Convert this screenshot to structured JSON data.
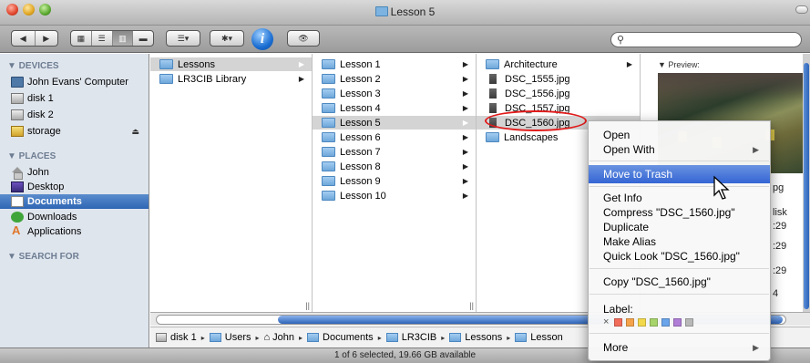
{
  "window": {
    "title": "Lesson 5"
  },
  "toolbar": {
    "nav": [
      "◀",
      "▶"
    ],
    "views": [
      "▦",
      "☰",
      "▥",
      "▬"
    ],
    "arrange": "☰▾",
    "action": "✱▾",
    "quicklook": "👁",
    "info": "i",
    "search_placeholder": ""
  },
  "sidebar": {
    "devices_heading": "▼ DEVICES",
    "devices": [
      {
        "label": "John Evans' Computer",
        "icon": "computer-icon"
      },
      {
        "label": "disk 1",
        "icon": "disk-icon"
      },
      {
        "label": "disk 2",
        "icon": "disk-icon"
      },
      {
        "label": "storage",
        "icon": "storage-icon"
      }
    ],
    "eject": "⏏",
    "places_heading": "▼ PLACES",
    "places": [
      {
        "label": "John",
        "icon": "home-icon"
      },
      {
        "label": "Desktop",
        "icon": "desktop-icon"
      },
      {
        "label": "Documents",
        "icon": "documents-icon",
        "selected": true
      },
      {
        "label": "Downloads",
        "icon": "downloads-icon"
      },
      {
        "label": "Applications",
        "icon": "applications-icon"
      }
    ],
    "search_heading": "▼ SEARCH FOR"
  },
  "columns": {
    "col1": [
      {
        "label": "Lessons",
        "selected": true,
        "arrow": "▶"
      },
      {
        "label": "LR3CIB Library",
        "arrow": "▶"
      }
    ],
    "col2": [
      {
        "label": "Lesson 1",
        "arrow": "▶"
      },
      {
        "label": "Lesson 2",
        "arrow": "▶"
      },
      {
        "label": "Lesson 3",
        "arrow": "▶"
      },
      {
        "label": "Lesson 4",
        "arrow": "▶"
      },
      {
        "label": "Lesson 5",
        "arrow": "▶",
        "selected": true
      },
      {
        "label": "Lesson 6",
        "arrow": "▶"
      },
      {
        "label": "Lesson 7",
        "arrow": "▶"
      },
      {
        "label": "Lesson 8",
        "arrow": "▶"
      },
      {
        "label": "Lesson 9",
        "arrow": "▶"
      },
      {
        "label": "Lesson 10",
        "arrow": "▶"
      }
    ],
    "col3": [
      {
        "label": "Architecture",
        "arrow": "▶",
        "type": "folder"
      },
      {
        "label": "DSC_1555.jpg",
        "type": "image"
      },
      {
        "label": "DSC_1556.jpg",
        "type": "image"
      },
      {
        "label": "DSC_1557.jpg",
        "type": "image"
      },
      {
        "label": "DSC_1560.jpg",
        "type": "image",
        "selected": true
      },
      {
        "label": "Landscapes",
        "type": "folder"
      }
    ],
    "resize_glyph": "||"
  },
  "preview": {
    "label": "▼ Preview:",
    "meta": [
      "pg",
      "lisk",
      ":29",
      ":29",
      ":29",
      "4"
    ]
  },
  "pathbar": [
    {
      "label": "disk 1",
      "icon": "disk-icon"
    },
    {
      "label": "Users",
      "icon": "folder-icon"
    },
    {
      "label": "John",
      "icon": "home-icon"
    },
    {
      "label": "Documents",
      "icon": "folder-icon"
    },
    {
      "label": "LR3CIB",
      "icon": "folder-icon"
    },
    {
      "label": "Lessons",
      "icon": "folder-icon"
    },
    {
      "label": "Lesson",
      "icon": "folder-icon"
    }
  ],
  "pathbar_sep": "▸",
  "status": "1 of 6 selected, 19.66 GB available",
  "context_menu": {
    "open": "Open",
    "open_with": "Open With",
    "move_to_trash": "Move to Trash",
    "get_info": "Get Info",
    "compress": "Compress \"DSC_1560.jpg\"",
    "duplicate": "Duplicate",
    "make_alias": "Make Alias",
    "quick_look": "Quick Look \"DSC_1560.jpg\"",
    "copy": "Copy \"DSC_1560.jpg\"",
    "label": "Label:",
    "label_none": "×",
    "label_colors": [
      "#f26c5a",
      "#f5a34b",
      "#f2d94b",
      "#a6d46a",
      "#6aa4ea",
      "#b07ed6",
      "#b8b8b8"
    ],
    "more": "More",
    "submenu_arrow": "▶"
  },
  "colors": {
    "selection": "#3465d4",
    "sidebar_bg": "#dfe5ed",
    "annotation": "#e21b1b"
  }
}
